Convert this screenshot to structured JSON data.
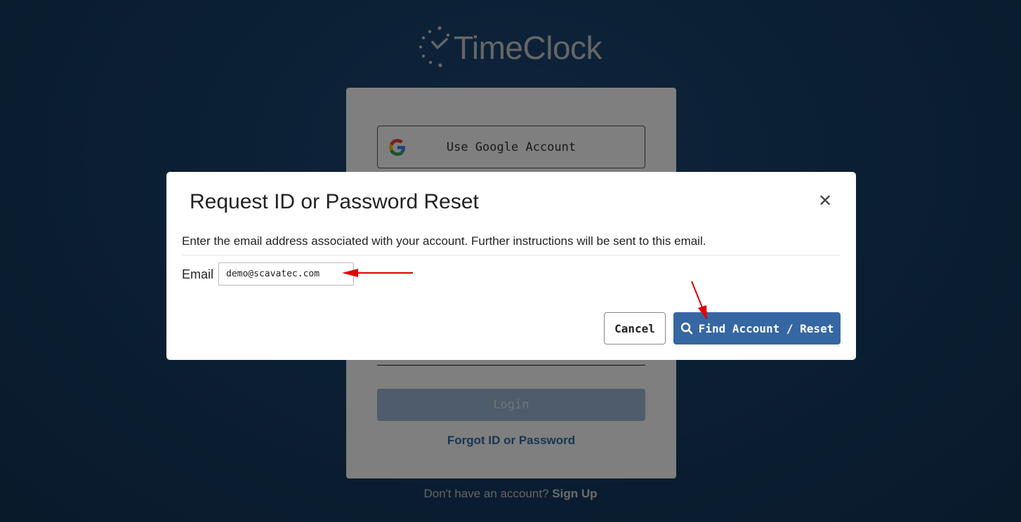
{
  "brand": {
    "name": "TimeClock",
    "logo_icon": "clock-dots-icon"
  },
  "login_card": {
    "google_button_label": "Use Google Account",
    "google_icon": "google-g-icon",
    "login_button_label": "Login",
    "forgot_link": "Forgot ID or Password",
    "signup_prompt": "Don't have an account?",
    "signup_link": "Sign Up"
  },
  "modal": {
    "title": "Request ID or Password Reset",
    "close_icon": "close-icon",
    "description": "Enter the email address associated with your account. Further instructions will be sent to this email.",
    "email_label": "Email",
    "email_value": "demo@scavatec.com",
    "cancel_label": "Cancel",
    "find_label": "Find Account / Reset",
    "find_icon": "search-icon"
  },
  "colors": {
    "background": "#173f68",
    "primary_button": "#3667a2",
    "annotation_arrow": "#e00000"
  }
}
